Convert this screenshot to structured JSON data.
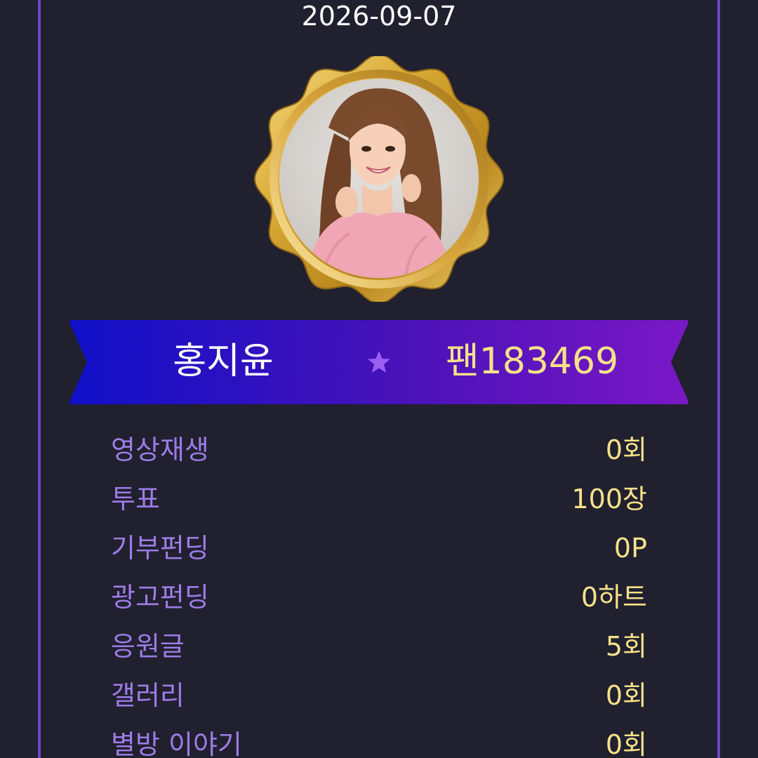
{
  "header": {
    "date": "2026-09-07"
  },
  "profile": {
    "photo_icon": "profile-photo",
    "frame_color": "#d4a62a"
  },
  "ribbon": {
    "name": "홍지윤",
    "fan_label": "팬183469",
    "star_icon": "star-icon",
    "gradient_start": "#1010c8",
    "gradient_end": "#7a18c6"
  },
  "stats": [
    {
      "label": "영상재생",
      "value": "0회"
    },
    {
      "label": "투표",
      "value": "100장"
    },
    {
      "label": "기부펀딩",
      "value": "0P"
    },
    {
      "label": "광고펀딩",
      "value": "0하트"
    },
    {
      "label": "응원글",
      "value": "5회"
    },
    {
      "label": "갤러리",
      "value": "0회"
    },
    {
      "label": "별방 이야기",
      "value": "0회"
    }
  ],
  "colors": {
    "background": "#20202f",
    "frame_line": "#6a48c0",
    "label": "#9d7ce6",
    "value": "#f6e189"
  }
}
